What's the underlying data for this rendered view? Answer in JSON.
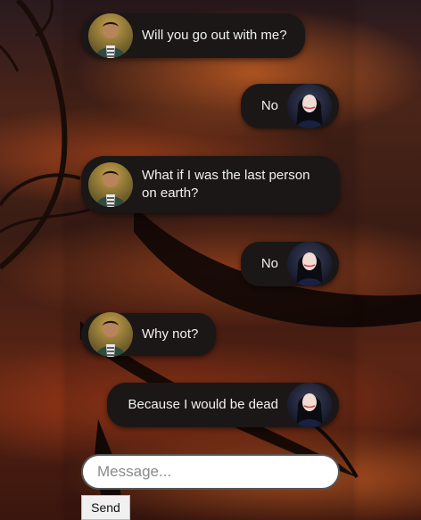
{
  "messages": [
    {
      "sender": "him",
      "side": "left",
      "text": "Will you go out with me?"
    },
    {
      "sender": "her",
      "side": "right",
      "text": "No"
    },
    {
      "sender": "him",
      "side": "left",
      "text": "What if I was the last person on earth?"
    },
    {
      "sender": "her",
      "side": "right",
      "text": "No"
    },
    {
      "sender": "him",
      "side": "left",
      "text": "Why not?"
    },
    {
      "sender": "her",
      "side": "right",
      "text": "Because I would be dead"
    }
  ],
  "composer": {
    "placeholder": "Message...",
    "value": "",
    "send_label": "Send"
  },
  "colors": {
    "bubble": "#1b1717",
    "bubble_text": "#f2f2f2"
  }
}
